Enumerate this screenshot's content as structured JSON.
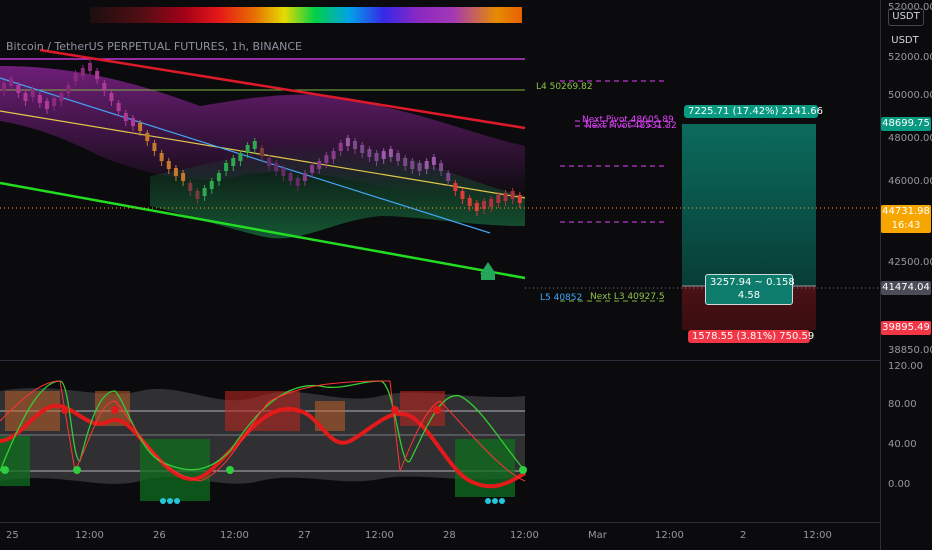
{
  "header": {
    "title": "Bitcoin / TetherUS PERPETUAL FUTURES, 1h, BINANCE"
  },
  "top_price_label": "52000.00",
  "currency_buttons": [
    "USDT",
    "USDT"
  ],
  "price_axis": [
    "52000.00",
    "50000.00",
    "48000.00",
    "46000.00",
    "42500.00",
    "38850.00"
  ],
  "price_tags": {
    "upper": "48699.75",
    "current_price": "44731.98",
    "current_time": "16:43",
    "mid": "41474.04",
    "lower": "39895.49"
  },
  "osc_axis": [
    "120.00",
    "80.00",
    "40.00",
    "0.00"
  ],
  "pivot_labels": {
    "l4": "L4 50269.82",
    "next_pivot": "Next Pivot 48605.89",
    "next_pivot_2": "Next Pivot 48531.32",
    "l5": "L5 40852",
    "next_l3": "Next L3 40927.5"
  },
  "position": {
    "target": "7225.71 (17.42%) 2141.66",
    "center_line1": "3257.94 ~ 0.158",
    "center_line2": "4.58",
    "stop": "1578.55 (3.81%) 750.59"
  },
  "time_axis": [
    "25",
    "12:00",
    "26",
    "12:00",
    "27",
    "12:00",
    "28",
    "12:00",
    "Mar",
    "12:00",
    "2",
    "12:00"
  ],
  "colors": {
    "target": "#089981",
    "stop": "#f23645",
    "current": "#f7a600",
    "pivot_pink": "#e040fb",
    "green_line": "#22dd22",
    "red_line": "#dd1a2a"
  }
}
